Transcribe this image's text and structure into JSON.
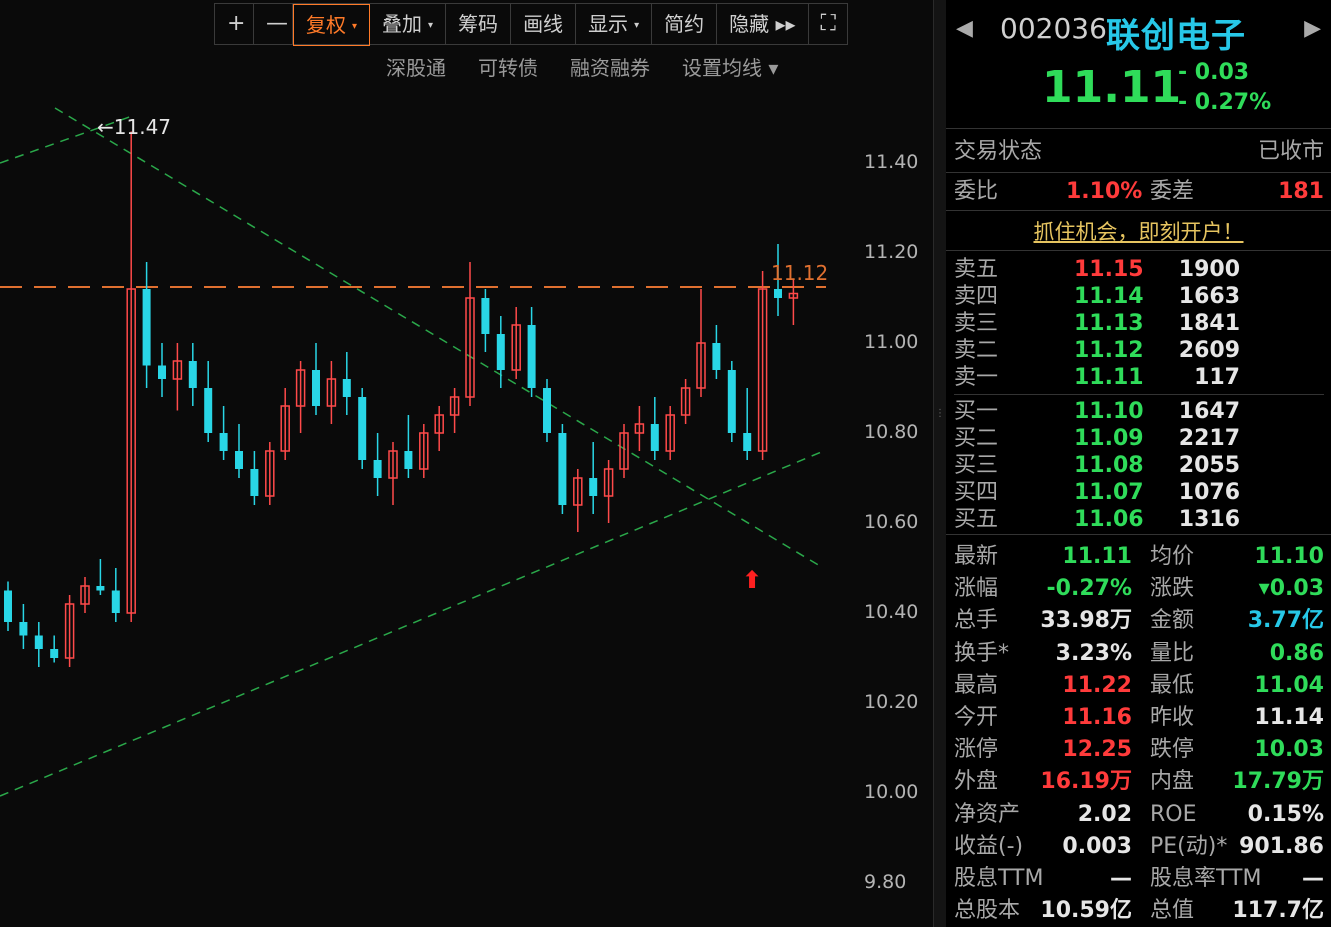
{
  "toolbar": {
    "plus": "+",
    "minus": "—",
    "items": [
      {
        "label": "复权",
        "caret": "▾"
      },
      {
        "label": "叠加",
        "caret": "▾"
      },
      {
        "label": "筹码",
        "caret": ""
      },
      {
        "label": "画线",
        "caret": ""
      },
      {
        "label": "显示",
        "caret": "▾"
      },
      {
        "label": "简约",
        "caret": ""
      },
      {
        "label": "隐藏 ▸▸",
        "caret": ""
      }
    ],
    "expand": "⛶"
  },
  "subbar": [
    "深股通",
    "可转债",
    "融资融券",
    "设置均线 ▾"
  ],
  "chart_data": {
    "type": "candlestick",
    "y_ticks": [
      "11.40",
      "11.20",
      "11.00",
      "10.80",
      "10.60",
      "10.40",
      "10.20",
      "10.00",
      "9.80"
    ],
    "ylim": [
      9.75,
      11.6
    ],
    "high_marker": "←11.47",
    "last_marker": "11.12",
    "last_price": 11.12,
    "up_color": "#ff4a4a",
    "down_color": "#29d6e6",
    "candles": [
      [
        10.45,
        10.47,
        10.36,
        10.38
      ],
      [
        10.38,
        10.42,
        10.32,
        10.35
      ],
      [
        10.35,
        10.38,
        10.28,
        10.32
      ],
      [
        10.32,
        10.35,
        10.29,
        10.3
      ],
      [
        10.3,
        10.44,
        10.28,
        10.42
      ],
      [
        10.42,
        10.48,
        10.4,
        10.46
      ],
      [
        10.46,
        10.52,
        10.44,
        10.45
      ],
      [
        10.45,
        10.5,
        10.38,
        10.4
      ],
      [
        10.4,
        11.47,
        10.38,
        11.12
      ],
      [
        11.12,
        11.18,
        10.9,
        10.95
      ],
      [
        10.95,
        11.0,
        10.88,
        10.92
      ],
      [
        10.92,
        11.0,
        10.85,
        10.96
      ],
      [
        10.96,
        11.0,
        10.86,
        10.9
      ],
      [
        10.9,
        10.96,
        10.78,
        10.8
      ],
      [
        10.8,
        10.86,
        10.74,
        10.76
      ],
      [
        10.76,
        10.82,
        10.7,
        10.72
      ],
      [
        10.72,
        10.76,
        10.64,
        10.66
      ],
      [
        10.66,
        10.78,
        10.64,
        10.76
      ],
      [
        10.76,
        10.9,
        10.74,
        10.86
      ],
      [
        10.86,
        10.96,
        10.8,
        10.94
      ],
      [
        10.94,
        11.0,
        10.84,
        10.86
      ],
      [
        10.86,
        10.96,
        10.82,
        10.92
      ],
      [
        10.92,
        10.98,
        10.84,
        10.88
      ],
      [
        10.88,
        10.9,
        10.72,
        10.74
      ],
      [
        10.74,
        10.8,
        10.66,
        10.7
      ],
      [
        10.7,
        10.78,
        10.64,
        10.76
      ],
      [
        10.76,
        10.84,
        10.7,
        10.72
      ],
      [
        10.72,
        10.82,
        10.7,
        10.8
      ],
      [
        10.8,
        10.86,
        10.76,
        10.84
      ],
      [
        10.84,
        10.9,
        10.8,
        10.88
      ],
      [
        10.88,
        11.18,
        10.86,
        11.1
      ],
      [
        11.1,
        11.12,
        10.98,
        11.02
      ],
      [
        11.02,
        11.06,
        10.9,
        10.94
      ],
      [
        10.94,
        11.08,
        10.92,
        11.04
      ],
      [
        11.04,
        11.08,
        10.88,
        10.9
      ],
      [
        10.9,
        10.92,
        10.78,
        10.8
      ],
      [
        10.8,
        10.82,
        10.62,
        10.64
      ],
      [
        10.64,
        10.72,
        10.58,
        10.7
      ],
      [
        10.7,
        10.78,
        10.62,
        10.66
      ],
      [
        10.66,
        10.74,
        10.6,
        10.72
      ],
      [
        10.72,
        10.82,
        10.7,
        10.8
      ],
      [
        10.8,
        10.86,
        10.76,
        10.82
      ],
      [
        10.82,
        10.88,
        10.74,
        10.76
      ],
      [
        10.76,
        10.86,
        10.74,
        10.84
      ],
      [
        10.84,
        10.92,
        10.82,
        10.9
      ],
      [
        10.9,
        11.12,
        10.88,
        11.0
      ],
      [
        11.0,
        11.04,
        10.92,
        10.94
      ],
      [
        10.94,
        10.96,
        10.78,
        10.8
      ],
      [
        10.8,
        10.9,
        10.74,
        10.76
      ],
      [
        10.76,
        11.16,
        10.74,
        11.12
      ],
      [
        11.12,
        11.22,
        11.06,
        11.1
      ],
      [
        11.1,
        11.14,
        11.04,
        11.11
      ]
    ]
  },
  "quote": {
    "nav_prev": "◀",
    "nav_next": "▶",
    "code": "002036",
    "name": "联创电子",
    "last": "11.11",
    "change": "- 0.03",
    "change_pct": "- 0.27%",
    "status_label": "交易状态",
    "status_value": "已收市",
    "weibi_label": "委比",
    "weibi_value": "1.10%",
    "weicha_label": "委差",
    "weicha_value": "181",
    "promo": "抓住机会，即刻开户！"
  },
  "orderbook": {
    "asks": [
      {
        "label": "卖五",
        "price": "11.15",
        "vol": "1900"
      },
      {
        "label": "卖四",
        "price": "11.14",
        "vol": "1663"
      },
      {
        "label": "卖三",
        "price": "11.13",
        "vol": "1841"
      },
      {
        "label": "卖二",
        "price": "11.12",
        "vol": "2609"
      },
      {
        "label": "卖一",
        "price": "11.11",
        "vol": "117"
      }
    ],
    "bids": [
      {
        "label": "买一",
        "price": "11.10",
        "vol": "1647"
      },
      {
        "label": "买二",
        "price": "11.09",
        "vol": "2217"
      },
      {
        "label": "买三",
        "price": "11.08",
        "vol": "2055"
      },
      {
        "label": "买四",
        "price": "11.07",
        "vol": "1076"
      },
      {
        "label": "买五",
        "price": "11.06",
        "vol": "1316"
      }
    ]
  },
  "stats": [
    {
      "l1": "最新",
      "v1": "11.11",
      "c1": "green",
      "l2": "均价",
      "v2": "11.10",
      "c2": "green"
    },
    {
      "l1": "涨幅",
      "v1": "-0.27%",
      "c1": "green",
      "l2": "涨跌",
      "v2": "▾0.03",
      "c2": "green"
    },
    {
      "l1": "总手",
      "v1": "33.98万",
      "c1": "white",
      "l2": "金额",
      "v2": "3.77亿",
      "c2": "cyan"
    },
    {
      "l1": "换手*",
      "v1": "3.23%",
      "c1": "white",
      "l2": "量比",
      "v2": "0.86",
      "c2": "green"
    },
    {
      "l1": "最高",
      "v1": "11.22",
      "c1": "red",
      "l2": "最低",
      "v2": "11.04",
      "c2": "green"
    },
    {
      "l1": "今开",
      "v1": "11.16",
      "c1": "red",
      "l2": "昨收",
      "v2": "11.14",
      "c2": "white"
    },
    {
      "l1": "涨停",
      "v1": "12.25",
      "c1": "red",
      "l2": "跌停",
      "v2": "10.03",
      "c2": "green"
    },
    {
      "l1": "外盘",
      "v1": "16.19万",
      "c1": "red",
      "l2": "内盘",
      "v2": "17.79万",
      "c2": "green"
    },
    {
      "l1": "净资产",
      "v1": "2.02",
      "c1": "white",
      "l2": "ROE",
      "v2": "0.15%",
      "c2": "white"
    },
    {
      "l1": "收益(-)",
      "v1": "0.003",
      "c1": "white",
      "l2": "PE(动)*",
      "v2": "901.86",
      "c2": "white"
    },
    {
      "l1": "股息TTM",
      "v1": "—",
      "c1": "white",
      "l2": "股息率TTM",
      "v2": "—",
      "c2": "white"
    },
    {
      "l1": "总股本",
      "v1": "10.59亿",
      "c1": "white",
      "l2": "总值",
      "v2": "117.7亿",
      "c2": "white"
    }
  ]
}
